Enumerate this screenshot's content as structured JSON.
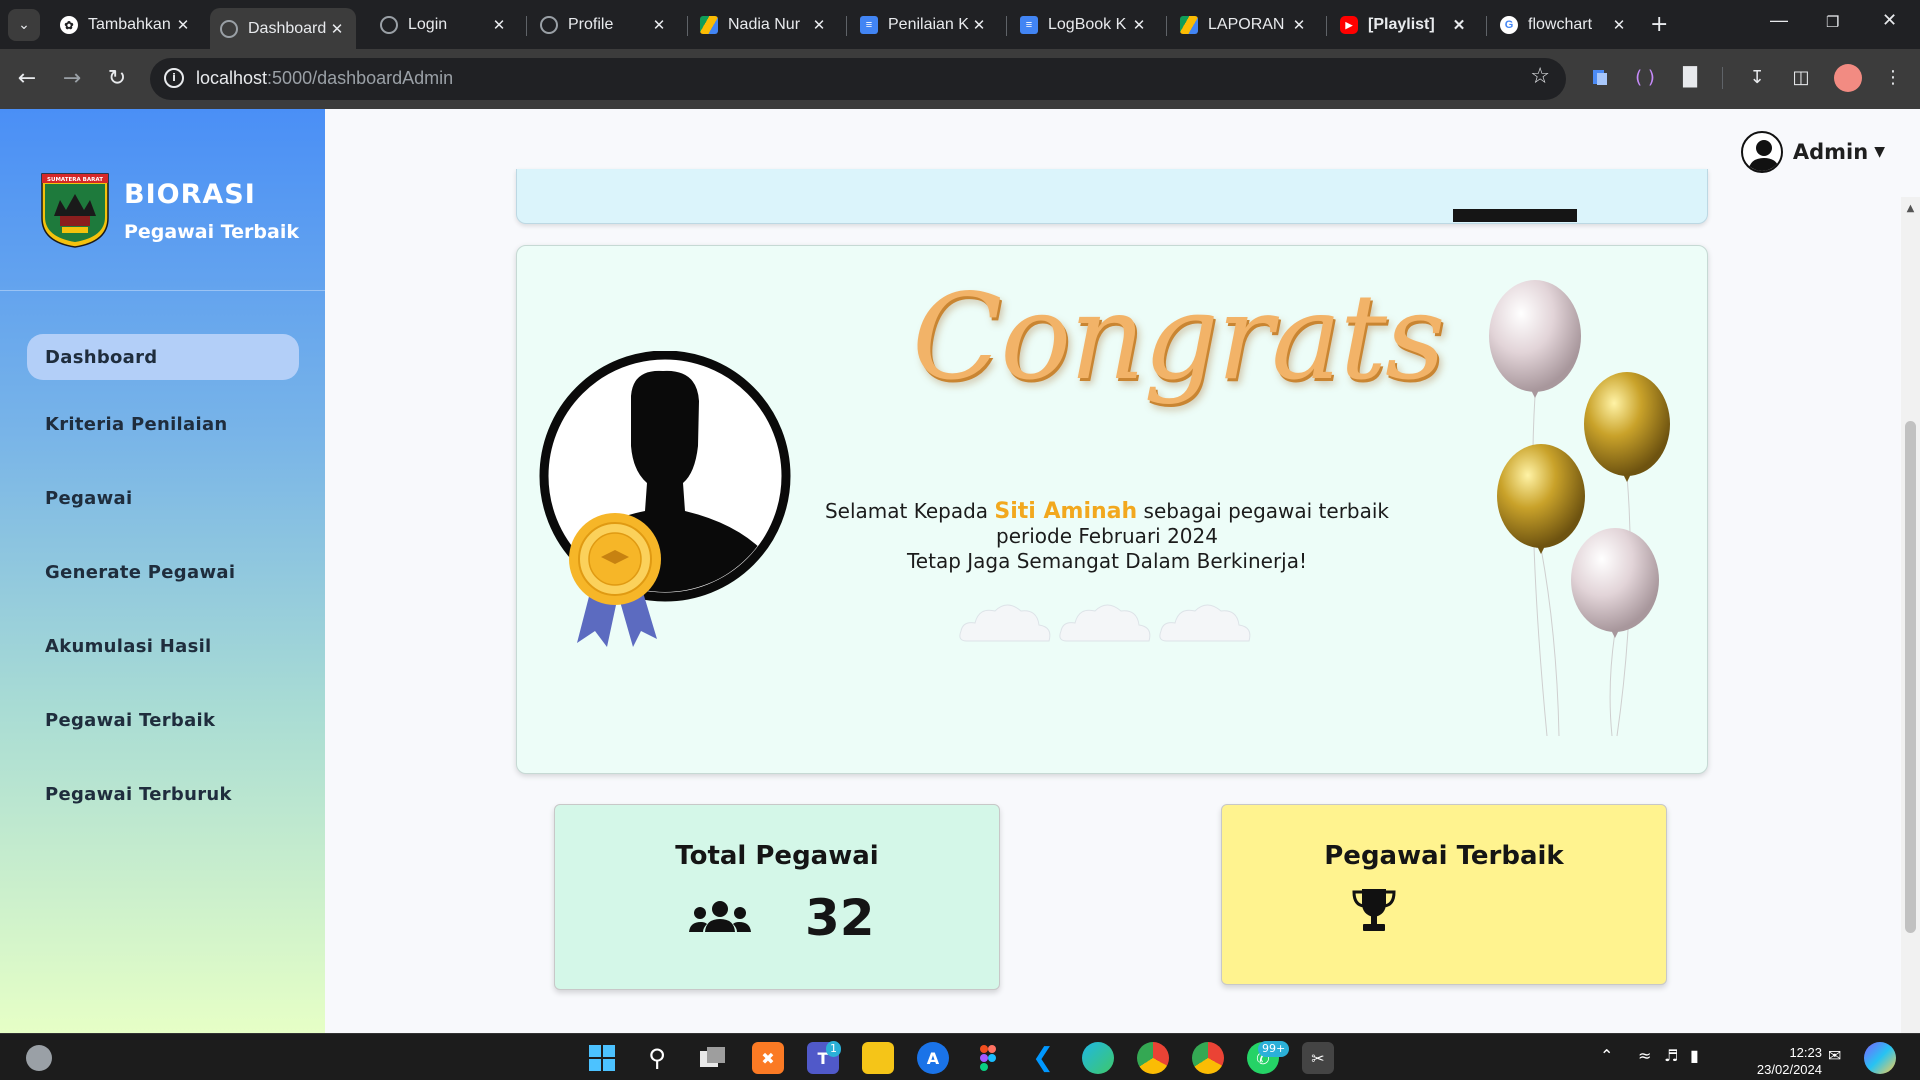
{
  "browser": {
    "tabs": [
      {
        "label": "Tambahkan",
        "icon": "chatgpt-icon",
        "color": "#7a7a7a"
      },
      {
        "label": "Dashboard",
        "icon": "globe-icon",
        "color": "#9aa0a6"
      },
      {
        "label": "Login",
        "icon": "globe-icon",
        "color": "#9aa0a6"
      },
      {
        "label": "Profile",
        "icon": "globe-icon",
        "color": "#9aa0a6"
      },
      {
        "label": "Nadia Nur",
        "icon": "drive-icon",
        "color": "#fbbc04"
      },
      {
        "label": "Penilaian K",
        "icon": "docs-icon",
        "color": "#4285f4"
      },
      {
        "label": "LogBook K",
        "icon": "docs-icon",
        "color": "#4285f4"
      },
      {
        "label": "LAPORAN",
        "icon": "drive-icon",
        "color": "#fbbc04"
      },
      {
        "label": "[Playlist]",
        "icon": "youtube-icon",
        "color": "#ff0000"
      },
      {
        "label": "flowchart",
        "icon": "google-icon",
        "color": "#ffffff"
      }
    ],
    "url_host": "localhost",
    "url_path": ":5000/dashboardAdmin"
  },
  "sidebar": {
    "brand_title": "BIORASI",
    "brand_subtitle": "Pegawai Terbaik",
    "logo_text": "SUMATERA BARAT",
    "items": [
      {
        "label": "Dashboard",
        "active": true
      },
      {
        "label": "Kriteria Penilaian",
        "active": false
      },
      {
        "label": "Pegawai",
        "active": false
      },
      {
        "label": "Generate Pegawai",
        "active": false
      },
      {
        "label": "Akumulasi Hasil",
        "active": false
      },
      {
        "label": "Pegawai Terbaik",
        "active": false
      },
      {
        "label": "Pegawai Terburuk",
        "active": false
      }
    ]
  },
  "header": {
    "user_name": "Admin"
  },
  "congrats": {
    "headline": "Congrats",
    "line1_prefix": "Selamat Kepada ",
    "winner_name": "Siti Aminah",
    "line1_suffix": " sebagai pegawai terbaik",
    "line2": "periode Februari 2024",
    "line3": "Tetap Jaga Semangat Dalam Berkinerja!",
    "headline_color": "#f2b368",
    "name_color": "#f2a81e"
  },
  "stats": {
    "total_pegawai": {
      "title": "Total Pegawai",
      "value": "32",
      "color": "#d4f7e8"
    },
    "pegawai_terbaik": {
      "title": "Pegawai Terbaik",
      "value": "",
      "color": "#fff38f"
    }
  },
  "taskbar": {
    "time": "12:23",
    "date": "23/02/2024",
    "teams_badge": "1",
    "whatsapp_badge": "99+"
  }
}
